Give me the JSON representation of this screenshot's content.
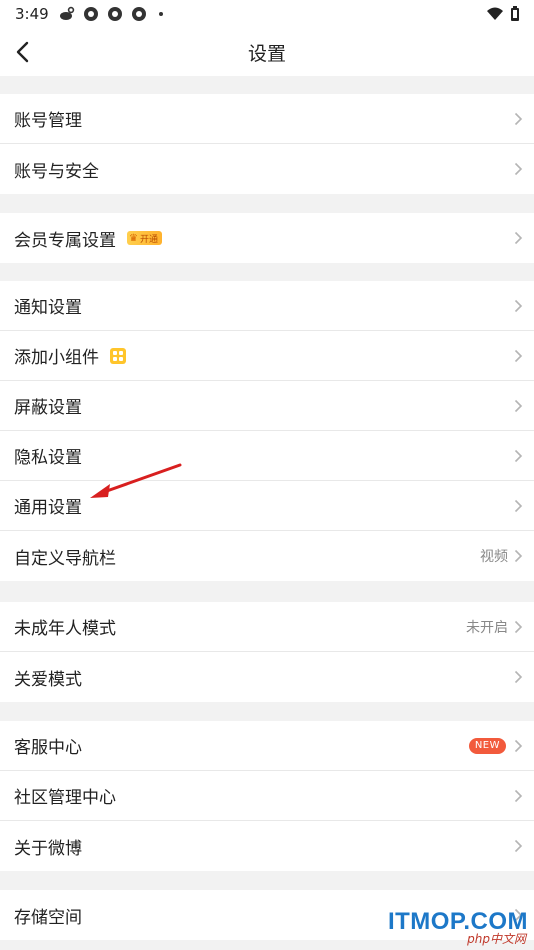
{
  "status_bar": {
    "time": "3:49"
  },
  "nav": {
    "title": "设置"
  },
  "groups": [
    {
      "items": [
        {
          "label": "账号管理"
        },
        {
          "label": "账号与安全"
        }
      ]
    },
    {
      "items": [
        {
          "label": "会员专属设置",
          "badge": "开通"
        }
      ]
    },
    {
      "items": [
        {
          "label": "通知设置"
        },
        {
          "label": "添加小组件"
        },
        {
          "label": "屏蔽设置"
        },
        {
          "label": "隐私设置"
        },
        {
          "label": "通用设置"
        },
        {
          "label": "自定义导航栏",
          "value": "视频"
        }
      ]
    },
    {
      "items": [
        {
          "label": "未成年人模式",
          "value": "未开启"
        },
        {
          "label": "关爱模式"
        }
      ]
    },
    {
      "items": [
        {
          "label": "客服中心",
          "badge": "NEW"
        },
        {
          "label": "社区管理中心"
        },
        {
          "label": "关于微博"
        }
      ]
    },
    {
      "items": [
        {
          "label": "存储空间"
        }
      ]
    }
  ],
  "watermark": {
    "main": "ITMOP.COM",
    "sub": "php中文网"
  },
  "colors": {
    "accent_red": "#f25a3c",
    "vip_gold": "#ffc52b",
    "arrow": "#d81f1f"
  }
}
